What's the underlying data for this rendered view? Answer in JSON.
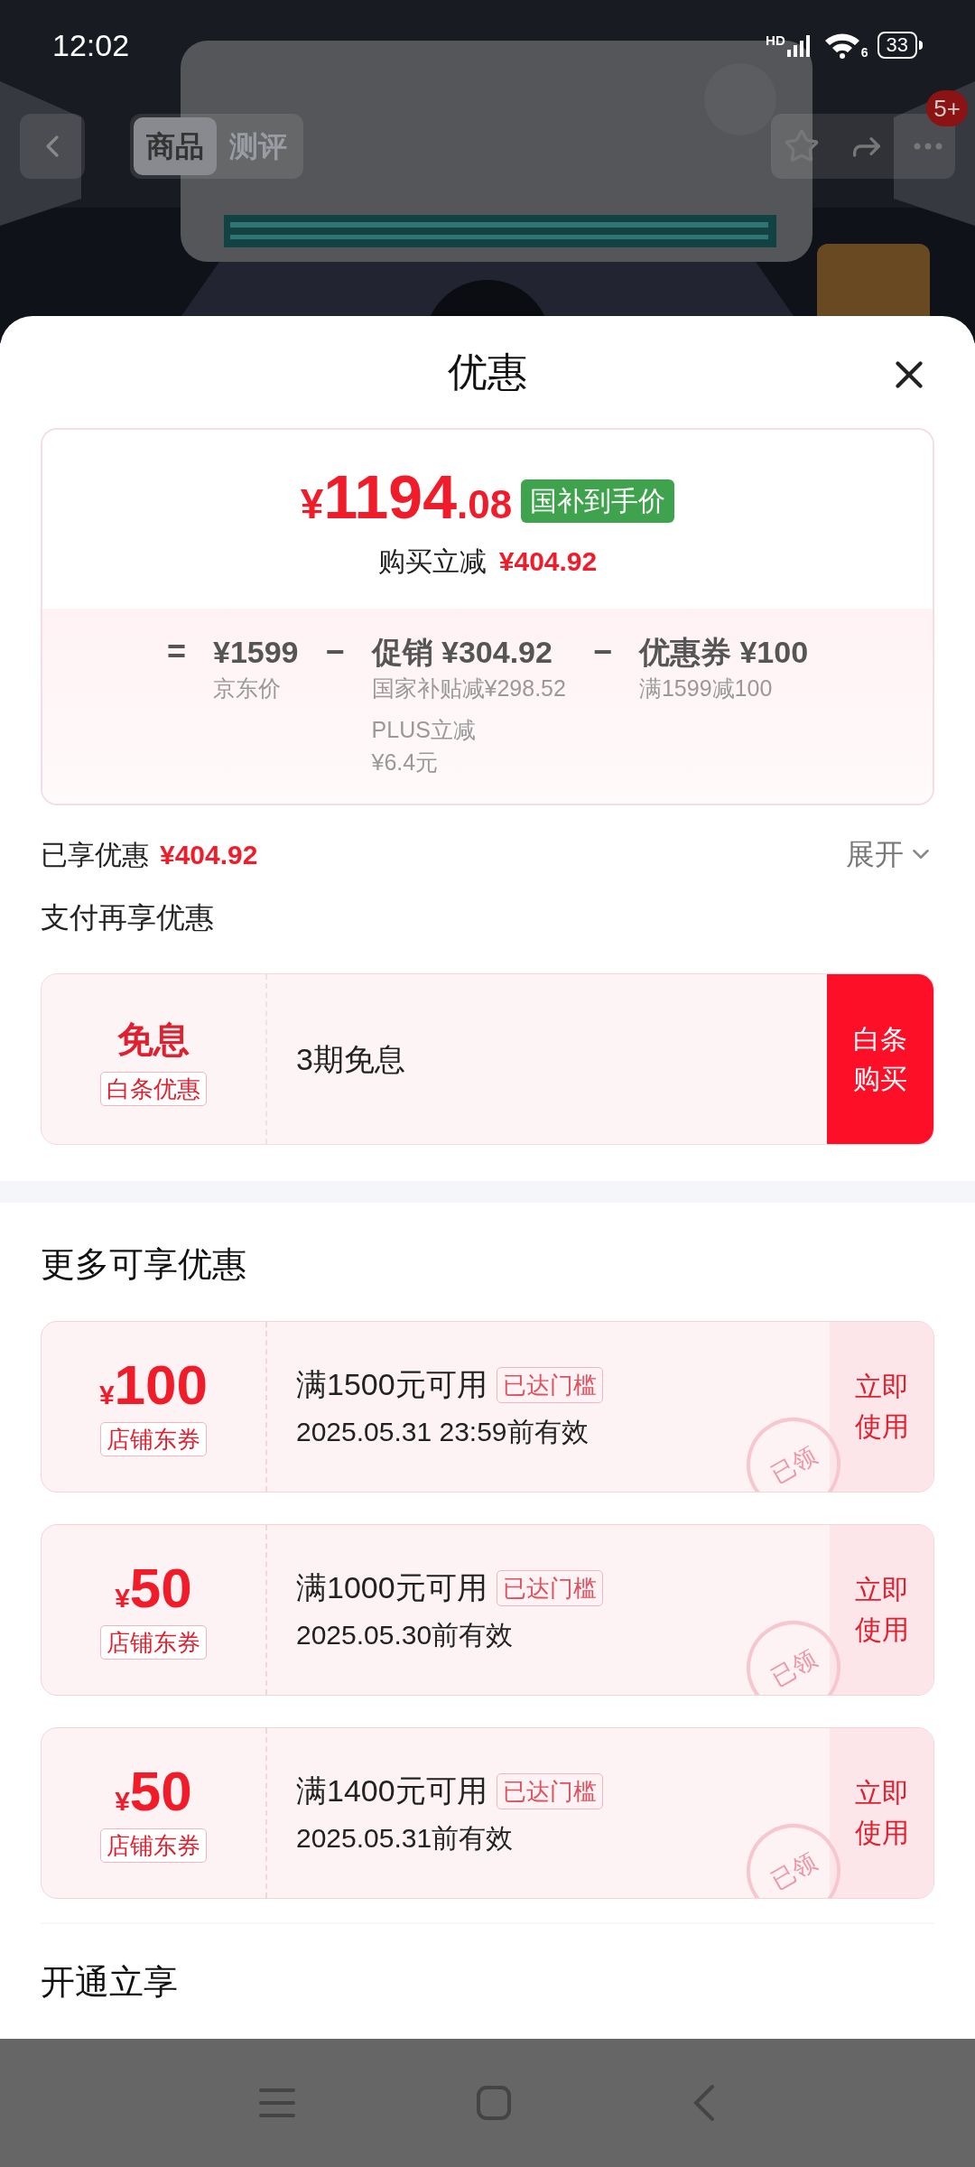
{
  "status_bar": {
    "time": "12:02",
    "network": "HD",
    "wifi_badge": "6",
    "battery": "33"
  },
  "top_bar": {
    "tabs": [
      {
        "label": "商品",
        "selected": true
      },
      {
        "label": "测评",
        "selected": false
      }
    ],
    "badge": "5+"
  },
  "sheet": {
    "title": "优惠"
  },
  "price_card": {
    "currency": "¥",
    "integer": "1194",
    "decimal": ".08",
    "tag": "国补到手价",
    "reduction_label": "购买立减",
    "reduction": "¥404.92",
    "breakdown": [
      {
        "operator": "=",
        "title": "¥1599",
        "notes": [
          "京东价"
        ]
      },
      {
        "operator": "−",
        "title": "促销 ¥304.92",
        "notes": [
          "国家补贴减¥298.52",
          "PLUS立减",
          "¥6.4元"
        ]
      },
      {
        "operator": "−",
        "title": "优惠券 ¥100",
        "notes": [
          "满1599减100"
        ]
      }
    ]
  },
  "enjoyed": {
    "label": "已享优惠",
    "amount": "¥404.92",
    "toggle": "展开",
    "expanded": false
  },
  "pay_section": {
    "title": "支付再享优惠",
    "offer": {
      "headline": "免息",
      "tag": "白条优惠",
      "text": "3期免息",
      "button": "白条购买"
    }
  },
  "more_section": {
    "title": "更多可享优惠",
    "coupons": [
      {
        "currency": "¥",
        "amount": "100",
        "type": "店铺东券",
        "condition": "满1500元可用",
        "badge": "已达门槛",
        "validity": "2025.05.31 23:59前有效",
        "action": "立即使用",
        "stamp": "已领"
      },
      {
        "currency": "¥",
        "amount": "50",
        "type": "店铺东券",
        "condition": "满1000元可用",
        "badge": "已达门槛",
        "validity": "2025.05.30前有效",
        "action": "立即使用",
        "stamp": "已领"
      },
      {
        "currency": "¥",
        "amount": "50",
        "type": "店铺东券",
        "condition": "满1400元可用",
        "badge": "已达门槛",
        "validity": "2025.05.31前有效",
        "action": "立即使用",
        "stamp": "已领"
      }
    ]
  },
  "open_section": {
    "title": "开通立享"
  }
}
